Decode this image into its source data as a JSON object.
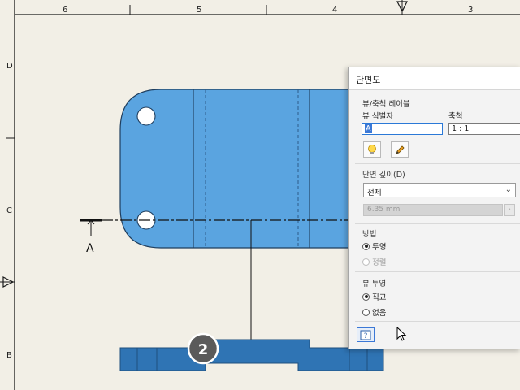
{
  "ruler": {
    "columns": [
      "6",
      "5",
      "4",
      "3"
    ],
    "rows": [
      "D",
      "C",
      "B"
    ]
  },
  "drawing": {
    "section_label": "A",
    "callout_number": "2",
    "part_color": "#5aa4e0",
    "section_color": "#2f74b4"
  },
  "dialog": {
    "title": "단면도",
    "view_scale_section": "뷰/축척 레이블",
    "view_id_label": "뷰 식별자",
    "view_id_value": "A",
    "scale_label": "축척",
    "scale_value": "1 : 1",
    "depth_section": "단면 깊이",
    "depth_mnemonic": "(D)",
    "depth_selected": "전체",
    "depth_value": "6.35 mm",
    "method_section": "방법",
    "method_options": [
      "투영",
      "정렬"
    ],
    "projection_section": "뷰 투영",
    "projection_options": [
      "직교",
      "없음"
    ]
  }
}
